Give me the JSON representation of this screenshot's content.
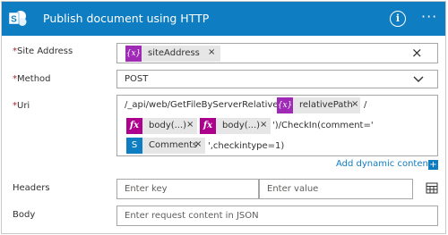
{
  "header": {
    "title": "Publish document using HTTP",
    "info_glyph": "i",
    "more_glyph": "···",
    "color": "#0f7dc2"
  },
  "fields": {
    "site_address": {
      "label": "Site Address",
      "required": "*",
      "token": {
        "icon": "variable-icon",
        "icon_text": "{x}",
        "text": "siteAddress",
        "remove": "×"
      },
      "clear": "×"
    },
    "method": {
      "label": "Method",
      "required": "*",
      "value": "POST"
    },
    "uri": {
      "label": "Uri",
      "required": "*",
      "line1_prefix": "/_api/web/GetFileByServerRelativeUrl('",
      "line1_token": {
        "icon": "variable-icon",
        "icon_text": "{x}",
        "text": "relativePath",
        "remove": "×"
      },
      "line1_suffix": "/",
      "line2_token1": {
        "icon": "expression-icon",
        "icon_text": "fx",
        "text": "body(...)",
        "remove": "×"
      },
      "line2_token2": {
        "icon": "expression-icon",
        "icon_text": "fx",
        "text": "body(...)",
        "remove": "×"
      },
      "line2_suffix": "')/CheckIn(comment='",
      "line3_token": {
        "icon": "sharepoint-icon",
        "icon_text": "S",
        "text": "Comments",
        "remove": "×"
      },
      "line3_suffix": "',checkintype=1)"
    },
    "add_dynamic": {
      "label": "Add dynamic content",
      "plus": "+"
    },
    "headers": {
      "label": "Headers",
      "key_placeholder": "Enter key",
      "value_placeholder": "Enter value"
    },
    "body": {
      "label": "Body",
      "placeholder": "Enter request content in JSON"
    }
  },
  "colors": {
    "accent": "#0f7dc2",
    "variable": "#9e2ab5",
    "expression": "#ad008c",
    "required": "#a4262c"
  }
}
